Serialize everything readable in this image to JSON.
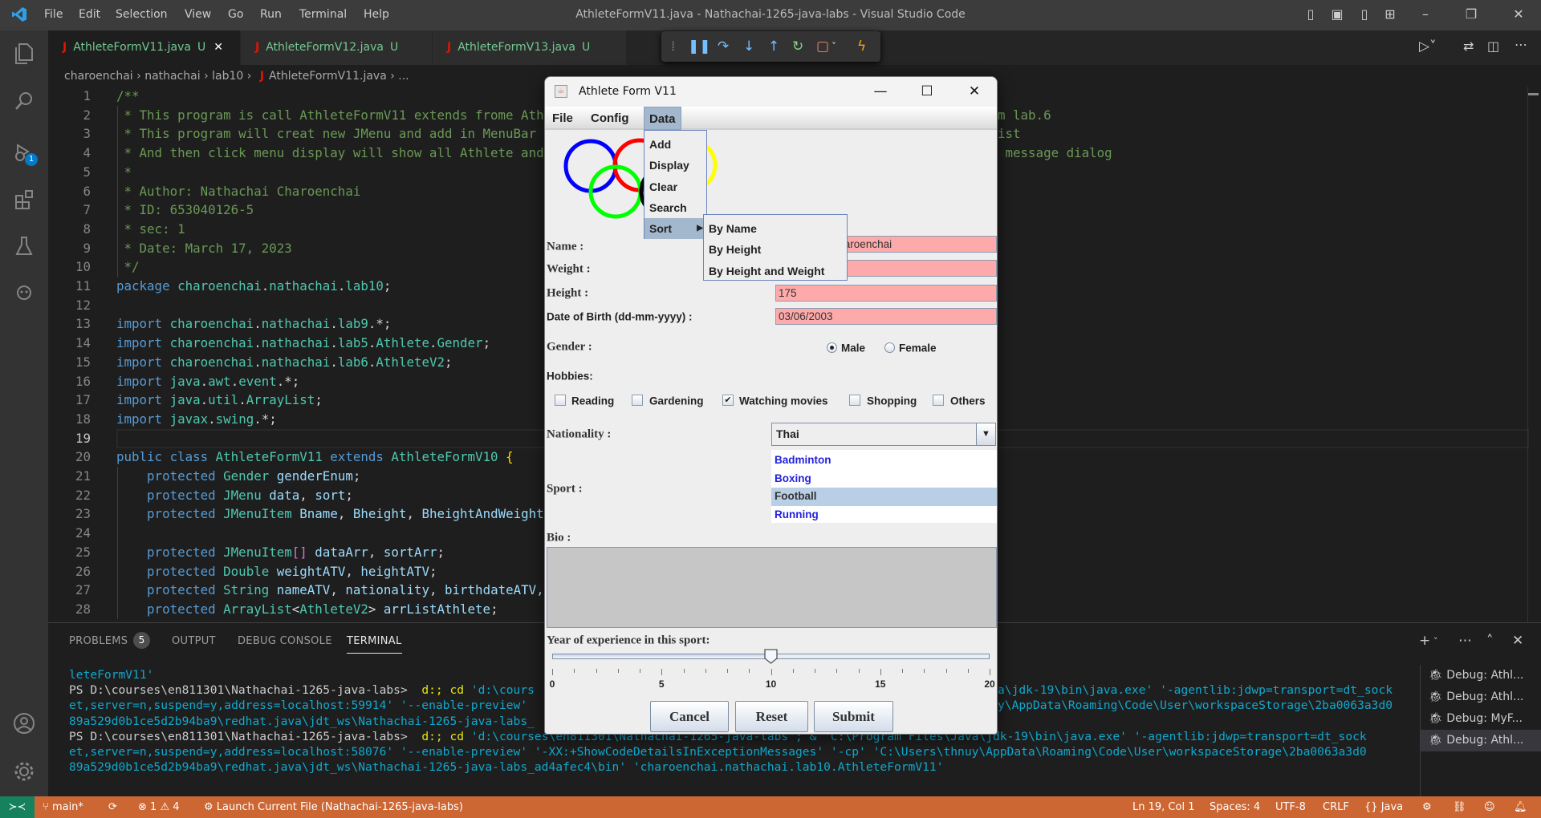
{
  "window": {
    "title": "AthleteFormV11.java - Nathachai-1265-java-labs - Visual Studio Code"
  },
  "menu": [
    "File",
    "Edit",
    "Selection",
    "View",
    "Go",
    "Run",
    "Terminal",
    "Help"
  ],
  "tabs": [
    {
      "label": "AthleteFormV11.java",
      "status": "U",
      "active": true
    },
    {
      "label": "AthleteFormV12.java",
      "status": "U",
      "active": false
    },
    {
      "label": "AthleteFormV13.java",
      "status": "U",
      "active": false
    }
  ],
  "activity_badge": "1",
  "breadcrumb": [
    "charoenchai",
    "nathachai",
    "lab10",
    "AthleteFormV11.java",
    "..."
  ],
  "editor": {
    "current_line": 19,
    "lines": [
      {
        "n": 1,
        "t": [
          [
            "/**",
            "c"
          ]
        ]
      },
      {
        "n": 2,
        "t": [
          [
            " * This program is call AthleteFormV11 extends frome Ath",
            "c"
          ]
        ],
        "tail": "m lab.6"
      },
      {
        "n": 3,
        "t": [
          [
            " * This program will creat new JMenu and add in MenuBar",
            "c"
          ]
        ],
        "tail": "ist"
      },
      {
        "n": 4,
        "t": [
          [
            " * And then click menu display will show all Athlete and",
            "c"
          ]
        ],
        "tail": " message dialog"
      },
      {
        "n": 5,
        "t": [
          [
            " *",
            "c"
          ]
        ]
      },
      {
        "n": 6,
        "t": [
          [
            " * Author: Nathachai Charoenchai",
            "c"
          ]
        ]
      },
      {
        "n": 7,
        "t": [
          [
            " * ID: 653040126-5",
            "c"
          ]
        ]
      },
      {
        "n": 8,
        "t": [
          [
            " * sec: 1",
            "c"
          ]
        ]
      },
      {
        "n": 9,
        "t": [
          [
            " * Date: March 17, 2023",
            "c"
          ]
        ]
      },
      {
        "n": 10,
        "t": [
          [
            " */",
            "c"
          ]
        ]
      },
      {
        "n": 11,
        "t": [
          [
            "package ",
            "k"
          ],
          [
            "charoenchai",
            "n"
          ],
          [
            ".",
            "p"
          ],
          [
            "nathachai",
            "n"
          ],
          [
            ".",
            "p"
          ],
          [
            "lab10",
            "n"
          ],
          [
            ";",
            "p"
          ]
        ]
      },
      {
        "n": 12,
        "t": []
      },
      {
        "n": 13,
        "t": [
          [
            "import ",
            "k"
          ],
          [
            "charoenchai",
            "n"
          ],
          [
            ".",
            "p"
          ],
          [
            "nathachai",
            "n"
          ],
          [
            ".",
            "p"
          ],
          [
            "lab9",
            "n"
          ],
          [
            ".*;",
            "p"
          ]
        ]
      },
      {
        "n": 14,
        "t": [
          [
            "import ",
            "k"
          ],
          [
            "charoenchai",
            "n"
          ],
          [
            ".",
            "p"
          ],
          [
            "nathachai",
            "n"
          ],
          [
            ".",
            "p"
          ],
          [
            "lab5",
            "n"
          ],
          [
            ".",
            "p"
          ],
          [
            "Athlete",
            "n"
          ],
          [
            ".",
            "p"
          ],
          [
            "Gender",
            "n"
          ],
          [
            ";",
            "p"
          ]
        ]
      },
      {
        "n": 15,
        "t": [
          [
            "import ",
            "k"
          ],
          [
            "charoenchai",
            "n"
          ],
          [
            ".",
            "p"
          ],
          [
            "nathachai",
            "n"
          ],
          [
            ".",
            "p"
          ],
          [
            "lab6",
            "n"
          ],
          [
            ".",
            "p"
          ],
          [
            "AthleteV2",
            "n"
          ],
          [
            ";",
            "p"
          ]
        ]
      },
      {
        "n": 16,
        "t": [
          [
            "import ",
            "k"
          ],
          [
            "java",
            "n"
          ],
          [
            ".",
            "p"
          ],
          [
            "awt",
            "n"
          ],
          [
            ".",
            "p"
          ],
          [
            "event",
            "n"
          ],
          [
            ".*;",
            "p"
          ]
        ]
      },
      {
        "n": 17,
        "t": [
          [
            "import ",
            "k"
          ],
          [
            "java",
            "n"
          ],
          [
            ".",
            "p"
          ],
          [
            "util",
            "n"
          ],
          [
            ".",
            "p"
          ],
          [
            "ArrayList",
            "n"
          ],
          [
            ";",
            "p"
          ]
        ]
      },
      {
        "n": 18,
        "t": [
          [
            "import ",
            "k"
          ],
          [
            "javax",
            "n"
          ],
          [
            ".",
            "p"
          ],
          [
            "swing",
            "n"
          ],
          [
            ".*;",
            "p"
          ]
        ]
      },
      {
        "n": 19,
        "t": []
      },
      {
        "n": 20,
        "t": [
          [
            "public class ",
            "k"
          ],
          [
            "AthleteFormV11",
            "n"
          ],
          [
            " extends ",
            "k"
          ],
          [
            "AthleteFormV10",
            "n"
          ],
          [
            " ",
            "p"
          ],
          [
            "{",
            "b"
          ]
        ]
      },
      {
        "n": 21,
        "t": [
          [
            "    protected ",
            "k"
          ],
          [
            "Gender",
            "n"
          ],
          [
            " genderEnum",
            "v"
          ],
          [
            ";",
            "p"
          ]
        ]
      },
      {
        "n": 22,
        "t": [
          [
            "    protected ",
            "k"
          ],
          [
            "JMenu",
            "n"
          ],
          [
            " data",
            "v"
          ],
          [
            ", ",
            "p"
          ],
          [
            "sort",
            "v"
          ],
          [
            ";",
            "p"
          ]
        ]
      },
      {
        "n": 23,
        "t": [
          [
            "    protected ",
            "k"
          ],
          [
            "JMenuItem",
            "n"
          ],
          [
            " Bname",
            "v"
          ],
          [
            ", ",
            "p"
          ],
          [
            "Bheight",
            "v"
          ],
          [
            ", ",
            "p"
          ],
          [
            "BheightAndWeight",
            "v"
          ]
        ]
      },
      {
        "n": 24,
        "t": []
      },
      {
        "n": 25,
        "t": [
          [
            "    protected ",
            "k"
          ],
          [
            "JMenuItem",
            "n"
          ],
          [
            "[]",
            "m"
          ],
          [
            " dataArr",
            "v"
          ],
          [
            ", ",
            "p"
          ],
          [
            "sortArr",
            "v"
          ],
          [
            ";",
            "p"
          ]
        ]
      },
      {
        "n": 26,
        "t": [
          [
            "    protected ",
            "k"
          ],
          [
            "Double",
            "n"
          ],
          [
            " weightATV",
            "v"
          ],
          [
            ", ",
            "p"
          ],
          [
            "heightATV",
            "v"
          ],
          [
            ";",
            "p"
          ]
        ]
      },
      {
        "n": 27,
        "t": [
          [
            "    protected ",
            "k"
          ],
          [
            "String",
            "n"
          ],
          [
            " nameATV",
            "v"
          ],
          [
            ", ",
            "p"
          ],
          [
            "nationality",
            "v"
          ],
          [
            ", ",
            "p"
          ],
          [
            "birthdateATV",
            "v"
          ],
          [
            ",",
            "p"
          ]
        ]
      },
      {
        "n": 28,
        "t": [
          [
            "    protected ",
            "k"
          ],
          [
            "ArrayList",
            "n"
          ],
          [
            "<",
            "p"
          ],
          [
            "AthleteV2",
            "n"
          ],
          [
            "> ",
            "p"
          ],
          [
            "arrListAthlete",
            "v"
          ],
          [
            ";",
            "p"
          ]
        ]
      }
    ]
  },
  "panel": {
    "tabs": [
      "PROBLEMS",
      "OUTPUT",
      "DEBUG CONSOLE",
      "TERMINAL"
    ],
    "problems_count": "5",
    "active_tab": "TERMINAL",
    "terminal_lines": [
      {
        "t": [
          [
            "leteFormV11'",
            ""
          ]
        ]
      },
      {
        "t": [
          [
            "PS D:\\courses\\en811301\\Nathachai-1265-java-labs> ",
            "pr"
          ],
          [
            " d:; cd",
            "y"
          ],
          [
            " 'd:\\cours",
            ""
          ]
        ],
        "tail": "a\\jdk-19\\bin\\java.exe' '-agentlib:jdwp=transport=dt_sock"
      },
      {
        "t": [
          [
            "et,server=n,suspend=y,address=localhost:59914' '--enable-preview'",
            ""
          ]
        ],
        "tail": "y\\AppData\\Roaming\\Code\\User\\workspaceStorage\\2ba0063a3d0"
      },
      {
        "t": [
          [
            "89a529d0b1ce5d2b94ba9\\redhat.java\\jdt_ws\\Nathachai-1265-java-labs_",
            ""
          ]
        ]
      },
      {
        "t": [
          [
            "PS D:\\courses\\en811301\\Nathachai-1265-java-labs> ",
            "pr"
          ],
          [
            " d:; cd",
            "y"
          ],
          [
            " 'd:\\courses\\en811301\\Nathachai-1265-java-labs'; & 'C:\\Program Files\\Java\\jdk-19\\bin\\java.exe' '-agentlib:jdwp=transport=dt_sock",
            ""
          ]
        ]
      },
      {
        "t": [
          [
            "et,server=n,suspend=y,address=localhost:58076' '--enable-preview' '-XX:+ShowCodeDetailsInExceptionMessages' '-cp' 'C:\\Users\\thnuy\\AppData\\Roaming\\Code\\User\\workspaceStorage\\2ba0063a3d0",
            ""
          ]
        ]
      },
      {
        "t": [
          [
            "89a529d0b1ce5d2b94ba9\\redhat.java\\jdt_ws\\Nathachai-1265-java-labs_ad4afec4\\bin' 'charoenchai.nathachai.lab10.AthleteFormV11'",
            ""
          ]
        ]
      }
    ],
    "terminals": [
      {
        "label": "Debug: Athl...",
        "active": false
      },
      {
        "label": "Debug: Athl...",
        "active": false
      },
      {
        "label": "Debug: MyF...",
        "active": false
      },
      {
        "label": "Debug: Athl...",
        "active": true
      }
    ]
  },
  "statusbar": {
    "branch": "main*",
    "errors": "1",
    "warnings": "4",
    "launch": "Launch Current File (Nathachai-1265-java-labs)",
    "position": "Ln 19, Col 1",
    "spaces": "Spaces: 4",
    "encoding": "UTF-8",
    "eol": "CRLF",
    "language": "Java",
    "color": "#cc6633"
  },
  "dialog": {
    "title": "Athlete Form V11",
    "menubar": [
      "File",
      "Config",
      "Data"
    ],
    "data_menu": [
      "Add",
      "Display",
      "Clear",
      "Search",
      "Sort"
    ],
    "sort_menu": [
      "By Name",
      "By Height",
      "By Height and Weight"
    ],
    "rings": [
      "#0000ff",
      "#ff0000",
      "#ffff00",
      "#00ff00",
      "#000000"
    ],
    "labels": {
      "name": "Name :",
      "weight": "Weight :",
      "height": "Height :",
      "dob": "Date of Birth (dd-mm-yyyy) :",
      "gender": "Gender :",
      "hobbies": "Hobbies:",
      "nationality": "Nationality :",
      "sport": "Sport :",
      "bio": "Bio :",
      "experience": "Year of experience in this sport:"
    },
    "fields": {
      "name": "Nathachai Charoenchai",
      "weight": "",
      "height": "175",
      "dob": "03/06/2003",
      "bio": ""
    },
    "gender": {
      "options": [
        "Male",
        "Female"
      ],
      "selected": "Male"
    },
    "hobbies": [
      {
        "label": "Reading",
        "checked": false
      },
      {
        "label": "Gardening",
        "checked": false
      },
      {
        "label": "Watching movies",
        "checked": true
      },
      {
        "label": "Shopping",
        "checked": false
      },
      {
        "label": "Others",
        "checked": false
      }
    ],
    "nationality": "Thai",
    "sports": [
      "Badminton",
      "Boxing",
      "Football",
      "Running"
    ],
    "sport_selected": "Football",
    "experience": {
      "min": 0,
      "max": 20,
      "value": 10,
      "major": 5,
      "minor": 1,
      "labels": [
        "0",
        "5",
        "10",
        "15",
        "20"
      ]
    },
    "buttons": [
      "Cancel",
      "Reset",
      "Submit"
    ],
    "field_color": "#ffaaaa"
  }
}
